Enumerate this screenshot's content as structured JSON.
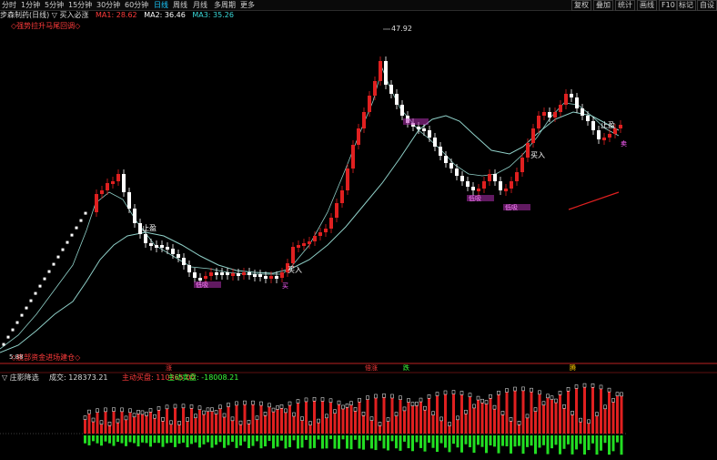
{
  "toolbar": {
    "periods": [
      "分时",
      "1分钟",
      "5分钟",
      "15分钟",
      "30分钟",
      "60分钟",
      "日线",
      "周线",
      "月线",
      "多周期",
      "更多"
    ],
    "active_period": "日线",
    "right_buttons": [
      "复权",
      "叠加",
      "统计",
      "画线",
      "F10",
      "标记",
      "自设"
    ]
  },
  "info": {
    "title": "步森制药(日线)  ▽ 买入必涨",
    "ma1": "MA1: 28.62",
    "ma2": "MA2: 36.46",
    "ma3": "MA3: 35.26",
    "ma1_color": "#ff3b3b",
    "ma2_color": "#ffffff",
    "ma3_color": "#3ad9d9"
  },
  "annotations": {
    "top_left": "◇强势拉升马尾回调◇",
    "bottom_left": "◇底部资金进场建仓◇",
    "price_high": "47.92",
    "price_low": "5.88",
    "stop_profit_1": "止盈",
    "stop_profit_2": "止盈",
    "buy_1": "买入",
    "buy_2": "买入",
    "zhang": "涨",
    "cheng_zhang": "倍涨",
    "die": "跌",
    "teng": "腾",
    "wash_1": "低吸",
    "wash_2": "低吸",
    "wash_3": "低吸",
    "sell_tag": "卖",
    "pink_tag": "买"
  },
  "indicator": {
    "name": "▽ 庄影降选",
    "volume_label": "成交: 128373.21",
    "active_buy_label": "主动买盘: 110365.00",
    "active_sell_label": "主动卖盘: -18008.21",
    "active_buy_color": "#ff3b3b",
    "active_sell_color": "#3bff3b"
  },
  "colors": {
    "up": "#e02020",
    "down": "#ffffff",
    "ma_line": "#8fd0c8",
    "highlight": "#e040e0"
  }
}
